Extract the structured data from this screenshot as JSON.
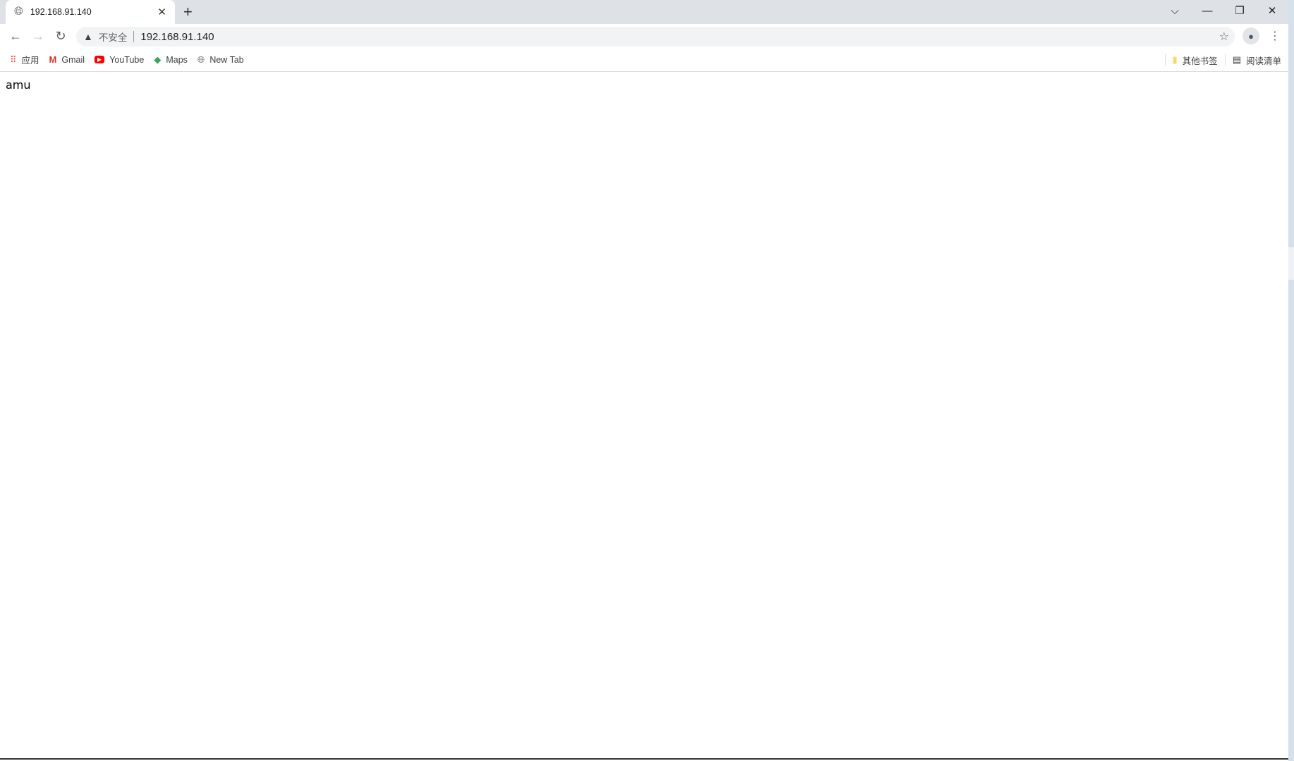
{
  "tab": {
    "title": "192.168.91.140",
    "icon": "globe-icon"
  },
  "omnibox": {
    "security_label": "不安全",
    "url": "192.168.91.140"
  },
  "bookmarks": [
    {
      "label": "应用",
      "icon": "apps-grid-icon"
    },
    {
      "label": "Gmail",
      "icon": "gmail-icon"
    },
    {
      "label": "YouTube",
      "icon": "youtube-icon"
    },
    {
      "label": "Maps",
      "icon": "maps-icon"
    },
    {
      "label": "New Tab",
      "icon": "globe-icon"
    }
  ],
  "bookmarks_right": {
    "other": "其他书签",
    "reading_list": "阅读清单"
  },
  "page": {
    "text": "amu"
  }
}
